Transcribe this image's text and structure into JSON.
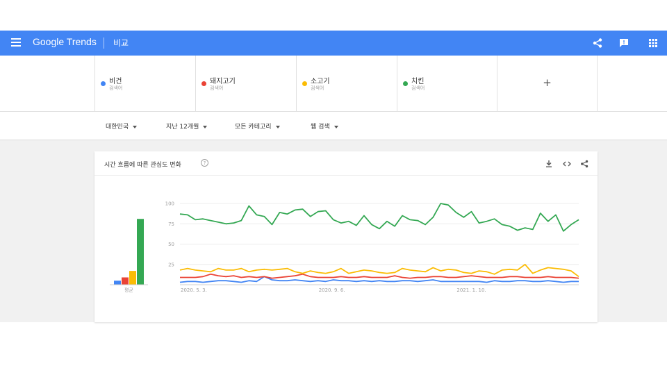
{
  "header": {
    "brand": "Google Trends",
    "page_title": "비교"
  },
  "terms": [
    {
      "name": "비건",
      "sub": "검색어",
      "color": "#4285f4"
    },
    {
      "name": "돼지고기",
      "sub": "검색어",
      "color": "#ea4335"
    },
    {
      "name": "소고기",
      "sub": "검색어",
      "color": "#fbbc04"
    },
    {
      "name": "치킨",
      "sub": "검색어",
      "color": "#34a853"
    }
  ],
  "add_term_label": "+",
  "filters": [
    "대한민국",
    "지난 12개월",
    "모든 카테고리",
    "웹 검색"
  ],
  "card": {
    "title": "시간 흐름에 따른 관심도 변화",
    "help": "?"
  },
  "chart_data": {
    "type": "line",
    "title": "시간 흐름에 따른 관심도 변화",
    "y_ticks": [
      25,
      50,
      75,
      100
    ],
    "ylim": [
      0,
      100
    ],
    "x_tick_labels": [
      {
        "index": 0,
        "label": "2020. 5. 3."
      },
      {
        "index": 18,
        "label": "2020. 9. 6."
      },
      {
        "index": 36,
        "label": "2021. 1. 10."
      }
    ],
    "average_label": "평균",
    "averages": [
      {
        "name": "비건",
        "value": 5
      },
      {
        "name": "돼지고기",
        "value": 9
      },
      {
        "name": "소고기",
        "value": 17
      },
      {
        "name": "치킨",
        "value": 81
      }
    ],
    "series": [
      {
        "name": "비건",
        "color": "#4285f4",
        "values": [
          3,
          4,
          4,
          3,
          4,
          5,
          5,
          4,
          3,
          5,
          4,
          10,
          6,
          5,
          5,
          6,
          5,
          4,
          5,
          4,
          6,
          5,
          5,
          4,
          5,
          4,
          5,
          4,
          4,
          5,
          5,
          4,
          5,
          6,
          4,
          4,
          4,
          4,
          4,
          4,
          3,
          5,
          4,
          4,
          5,
          5,
          4,
          4,
          5,
          4,
          3,
          4,
          4
        ]
      },
      {
        "name": "돼지고기",
        "color": "#ea4335",
        "values": [
          9,
          9,
          9,
          10,
          13,
          11,
          10,
          11,
          9,
          10,
          9,
          10,
          8,
          9,
          10,
          11,
          13,
          10,
          9,
          9,
          9,
          10,
          9,
          9,
          10,
          9,
          9,
          9,
          11,
          9,
          8,
          9,
          9,
          10,
          10,
          9,
          9,
          10,
          11,
          10,
          9,
          9,
          9,
          10,
          10,
          9,
          9,
          9,
          10,
          9,
          9,
          9,
          8
        ]
      },
      {
        "name": "소고기",
        "color": "#fbbc04",
        "values": [
          18,
          20,
          18,
          17,
          16,
          20,
          18,
          18,
          20,
          16,
          18,
          19,
          18,
          19,
          20,
          16,
          14,
          17,
          15,
          14,
          16,
          20,
          14,
          16,
          18,
          17,
          15,
          14,
          15,
          20,
          18,
          17,
          16,
          21,
          17,
          19,
          18,
          15,
          14,
          17,
          16,
          13,
          18,
          19,
          18,
          25,
          14,
          18,
          21,
          20,
          19,
          17,
          10
        ]
      },
      {
        "name": "치킨",
        "color": "#34a853",
        "values": [
          87,
          86,
          80,
          81,
          79,
          77,
          75,
          76,
          79,
          97,
          86,
          84,
          74,
          89,
          87,
          92,
          93,
          84,
          90,
          91,
          80,
          76,
          78,
          73,
          85,
          74,
          69,
          78,
          72,
          85,
          80,
          79,
          74,
          83,
          100,
          98,
          89,
          83,
          90,
          76,
          78,
          81,
          74,
          72,
          67,
          70,
          68,
          88,
          78,
          86,
          66,
          74,
          80
        ]
      }
    ]
  }
}
